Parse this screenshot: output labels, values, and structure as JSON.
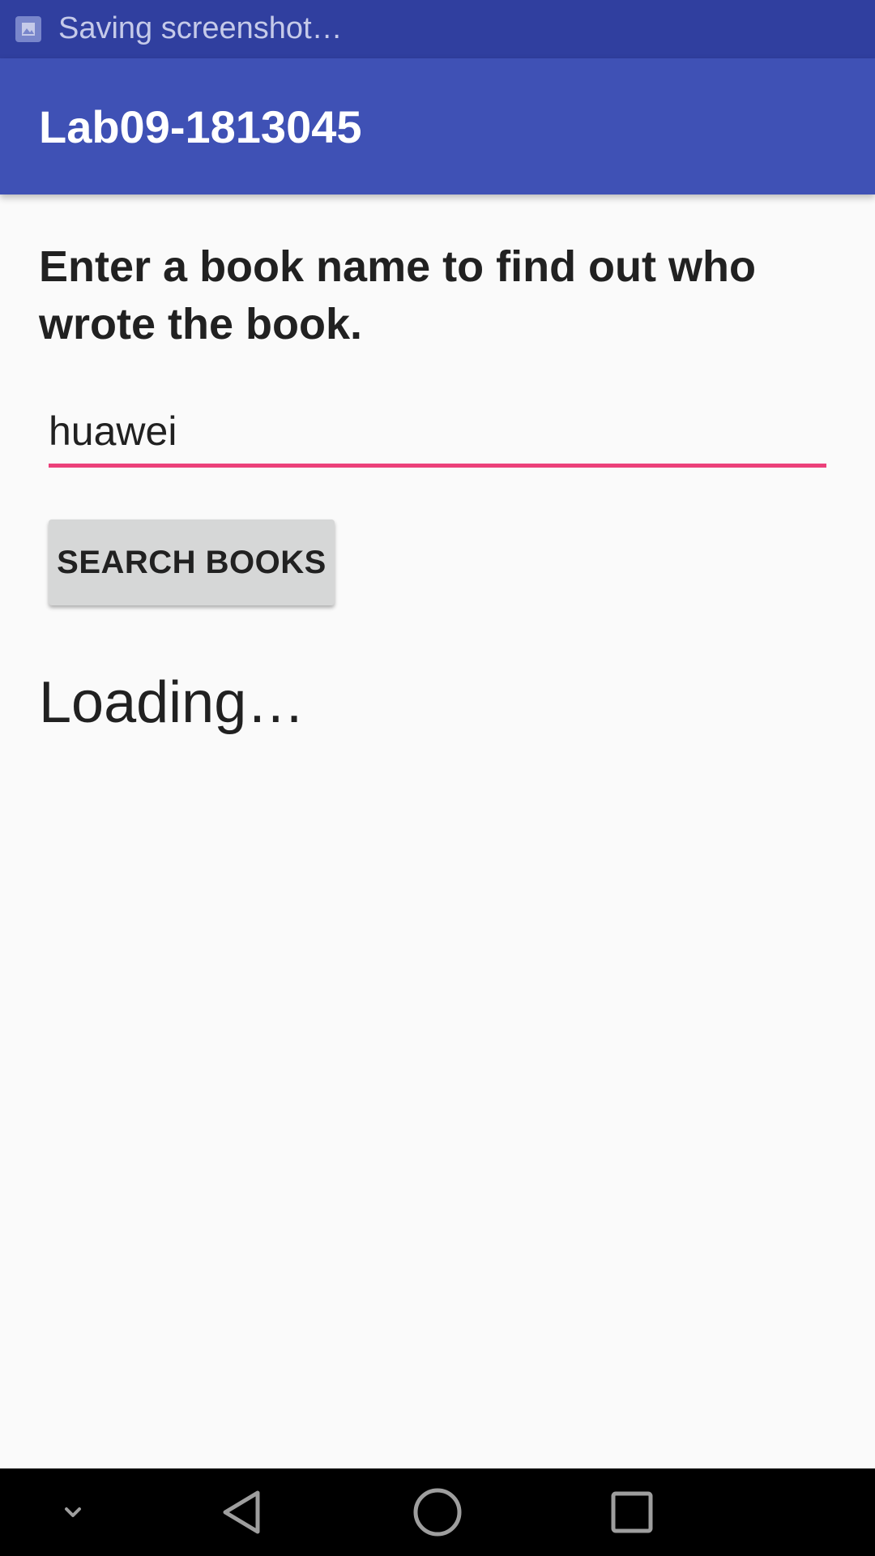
{
  "status_bar": {
    "notification_icon": "screenshot-icon",
    "notification_text": "Saving screenshot…"
  },
  "app_bar": {
    "title": "Lab09-1813045"
  },
  "main": {
    "prompt": "Enter a book name to find out who wrote the book.",
    "book_input": {
      "value": "huawei",
      "placeholder": ""
    },
    "search_button_label": "SEARCH BOOKS",
    "result_text": "Loading…"
  },
  "nav_bar": {
    "icons": [
      "chevron-down-icon",
      "back-icon",
      "home-icon",
      "recents-icon"
    ]
  },
  "colors": {
    "status_bar": "#303f9f",
    "app_bar": "#3f51b5",
    "accent": "#ec407a",
    "background": "#fafafa",
    "button": "#d6d7d7",
    "nav_bar": "#000000"
  }
}
